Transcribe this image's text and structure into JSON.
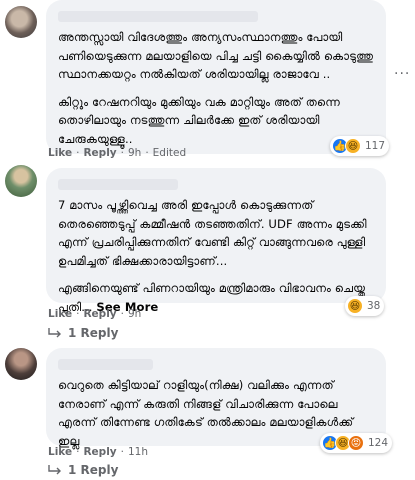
{
  "comments": [
    {
      "paragraphs": [
        "അന്തസ്സായി വിദേശത്തും അന്യസംസ്ഥാനത്തും പോയി പണിയെടുക്കുന്ന മലയാളിയെ പിച്ച ചട്ടി കൈയ്യിൽ കൊടുത്തു സ്ഥാനക്കയറ്റം നൽകിയത് ശരിയായില്ല രാജാവേ ..",
        "കിറ്റും റേഷനറിയും മുക്കിയും വക മാറ്റിയും അത് തന്നെ തൊഴിലായും നടത്തുന്ന ചിലർക്കേ ഇത് ശരിയായി ചേരുകയുള്ളൂ.."
      ],
      "reaction_count": "117",
      "reactions": [
        "like-icon",
        "haha-icon"
      ],
      "actions": {
        "like": "Like",
        "reply": "Reply",
        "time": "9h",
        "edited": "Edited"
      }
    },
    {
      "paragraphs": [
        "7 മാസം പൂഴ്ത്തിവെച്ച അരി ഇപ്പോൾ കൊടുക്കുന്നത് തെരഞ്ഞെടുപ്പ് കമ്മീഷൻ തടഞ്ഞതിന്. UDF അന്നം മുടക്കി എന്ന് പ്രചരിപ്പിക്കുന്നതിന് വേണ്ടി കിറ്റ് വാങ്ങുന്നവരെ പുള്ളി ഉപമിച്ചത് ഭിക്ഷക്കാരായിട്ടാണ്...",
        "എങ്ങിനെയുണ്ട് പിണറായിയും മന്ത്രിമാരും വിഭാവനം ചെയ്ത പുതി..."
      ],
      "see_more": "See More",
      "reaction_count": "38",
      "reactions": [
        "haha-icon"
      ],
      "actions": {
        "like": "Like",
        "reply": "Reply",
        "time": "9h"
      },
      "reply_link": "1 Reply"
    },
    {
      "paragraphs": [
        "വെറുതെ കിട്ടിയാല് റാളിയും(നിക്ഷ) വലിക്കും എന്നത് നേരാണ് എന്ന് കരുതി നിങ്ങള് വിചാരിക്കുന്ന പോലെ എരന്ന് തിന്നേണ്ട ഗതികേട് തൽക്കാലം മലയാളികൾക്ക് ഇല്ല"
      ],
      "reaction_count": "124",
      "reactions": [
        "like-icon",
        "haha-icon",
        "angry-icon"
      ],
      "actions": {
        "like": "Like",
        "reply": "Reply",
        "time": "11h"
      },
      "reply_link": "1 Reply"
    }
  ],
  "menu_icon": "more-horizontal-icon",
  "colors": {
    "bubble": "#f0f2f5",
    "meta": "#65676b",
    "like": "#1877f2",
    "haha": "#f7b125",
    "angry": "#e9710f"
  }
}
